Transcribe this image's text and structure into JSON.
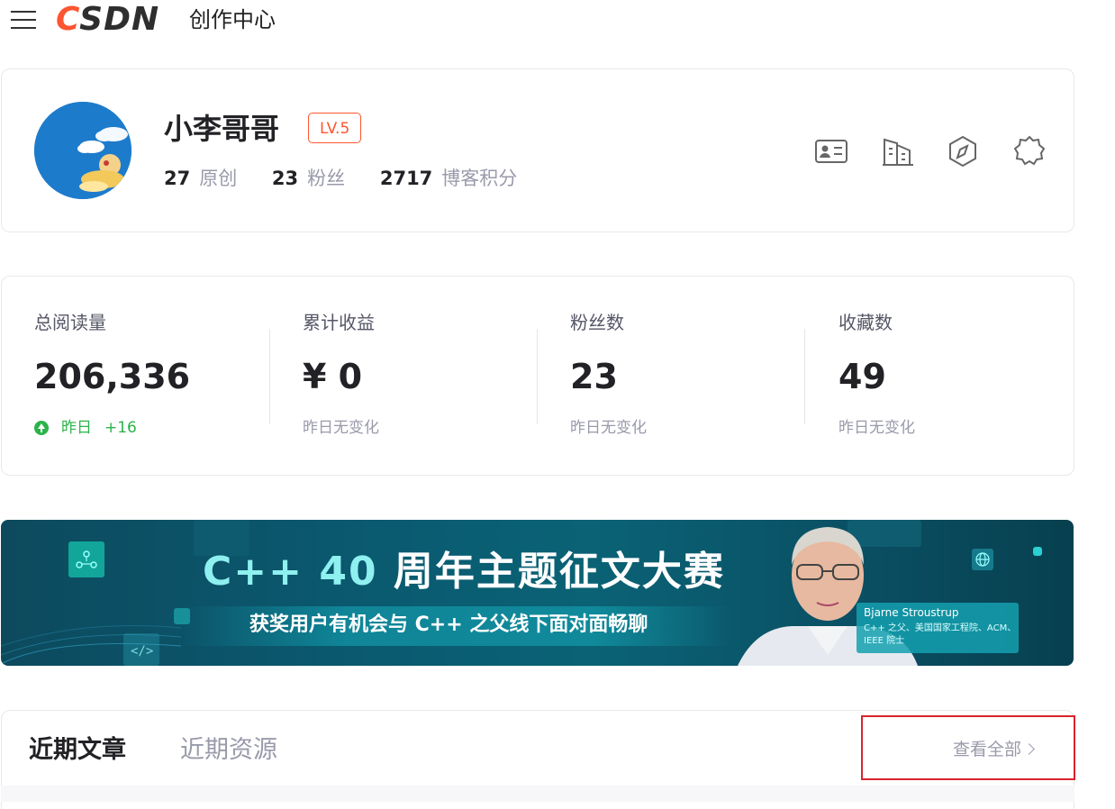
{
  "header": {
    "logo_c": "C",
    "logo_rest": "SDN",
    "page_title": "创作中心"
  },
  "profile": {
    "username": "小李哥哥",
    "level": "LV.5",
    "stats": [
      {
        "num": "27",
        "label": "原创"
      },
      {
        "num": "23",
        "label": "粉丝"
      },
      {
        "num": "2717",
        "label": "博客积分"
      }
    ],
    "quick_icons": [
      "id-card-icon",
      "building-icon",
      "compass-icon",
      "badge-icon"
    ]
  },
  "metrics": [
    {
      "label": "总阅读量",
      "value": "206,336",
      "delta_prefix": "昨日",
      "delta_value": "+16",
      "trend": "up"
    },
    {
      "label": "累计收益",
      "value": "¥ 0",
      "delta_text": "昨日无变化",
      "trend": "flat"
    },
    {
      "label": "粉丝数",
      "value": "23",
      "delta_text": "昨日无变化",
      "trend": "flat"
    },
    {
      "label": "收藏数",
      "value": "49",
      "delta_text": "昨日无变化",
      "trend": "flat"
    }
  ],
  "banner": {
    "title_cpp": "C++ 40",
    "title_rest": " 周年主题征文大赛",
    "subtitle": "获奖用户有机会与 C++ 之父线下面对面畅聊",
    "person_name": "Bjarne Stroustrup",
    "person_desc": "C++ 之父、美国国家工程院、ACM、IEEE 院士"
  },
  "recent": {
    "tabs": [
      {
        "label": "近期文章",
        "active": true
      },
      {
        "label": "近期资源",
        "active": false
      }
    ],
    "view_all": "查看全部"
  },
  "colors": {
    "brand": "#fc5531",
    "up": "#2bb34a",
    "muted": "#999aaa",
    "highlight": "#d9232e"
  }
}
